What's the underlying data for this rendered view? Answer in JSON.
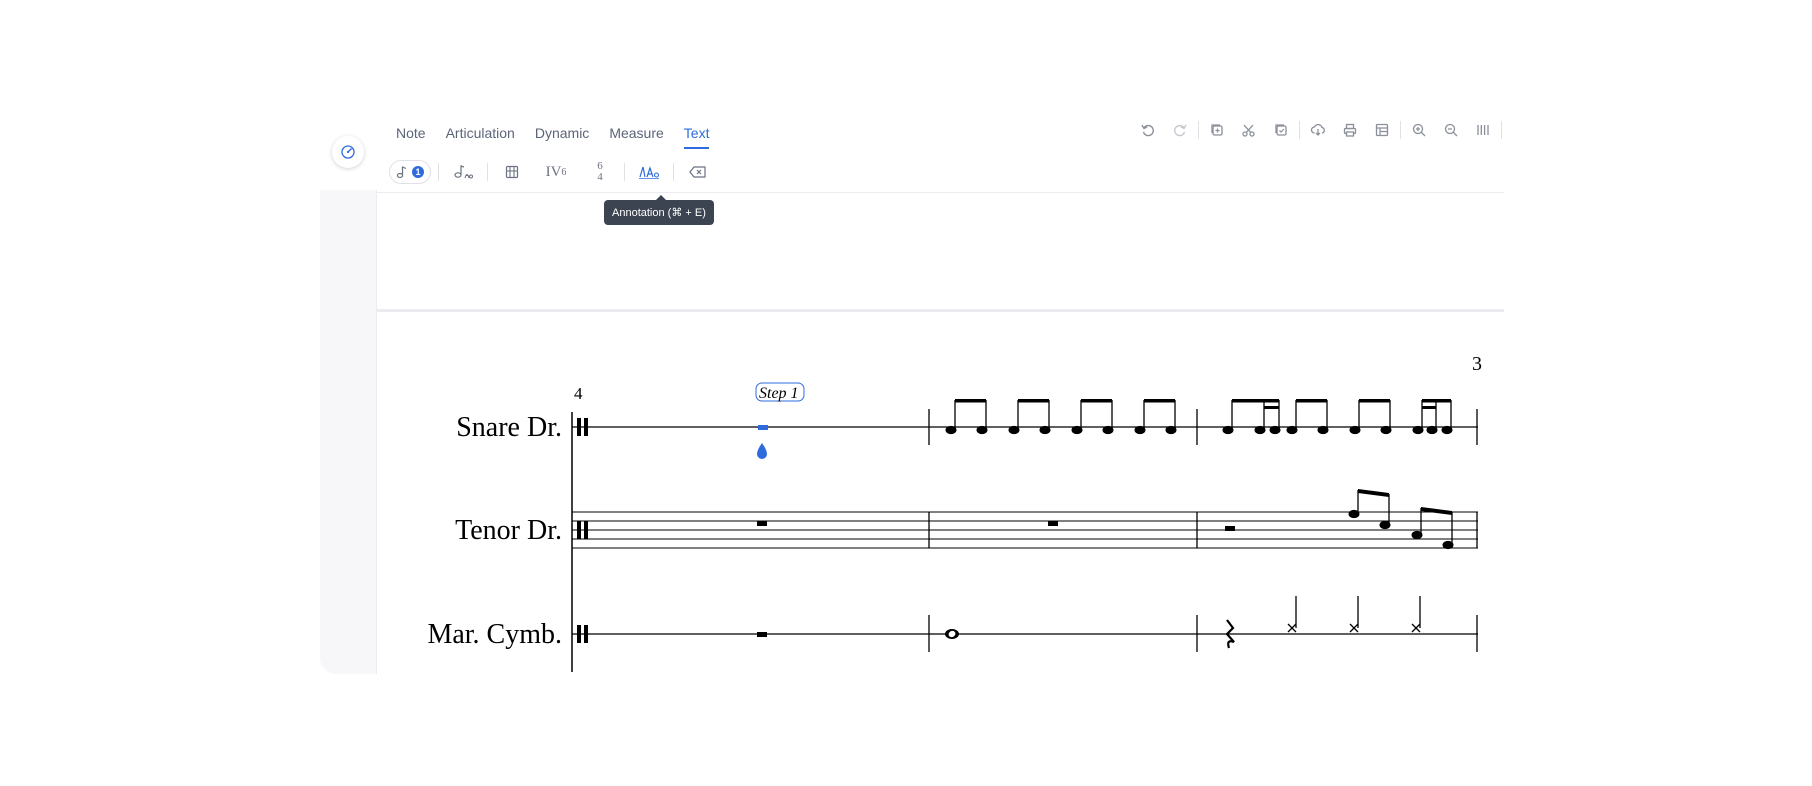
{
  "tabs": [
    {
      "label": "Note",
      "active": false
    },
    {
      "label": "Articulation",
      "active": false
    },
    {
      "label": "Dynamic",
      "active": false
    },
    {
      "label": "Measure",
      "active": false
    },
    {
      "label": "Text",
      "active": true
    }
  ],
  "toolbar": {
    "right_icons": [
      "undo-icon",
      "redo-icon",
      "add-copy-icon",
      "scissors-icon",
      "paste-icon",
      "cloud-download-icon",
      "print-icon",
      "layout-icon",
      "zoom-in-icon",
      "zoom-out-icon",
      "view-bars-icon"
    ]
  },
  "text_tools": {
    "voice_badge": "1",
    "roman_numeral": "IV",
    "roman_sup": "6",
    "figured_top": "6",
    "figured_bottom": "4",
    "tooltip": "Annotation (⌘ + E)"
  },
  "score": {
    "measure_start_number": "4",
    "system_measure_number": "3",
    "annotation_text": "Step 1",
    "instruments": [
      "Snare Dr.",
      "Tenor Dr.",
      "Mar. Cymb."
    ]
  },
  "colors": {
    "accent": "#2f6bdc",
    "tab_text": "#5b6478",
    "tooltip_bg": "#3c4351"
  }
}
